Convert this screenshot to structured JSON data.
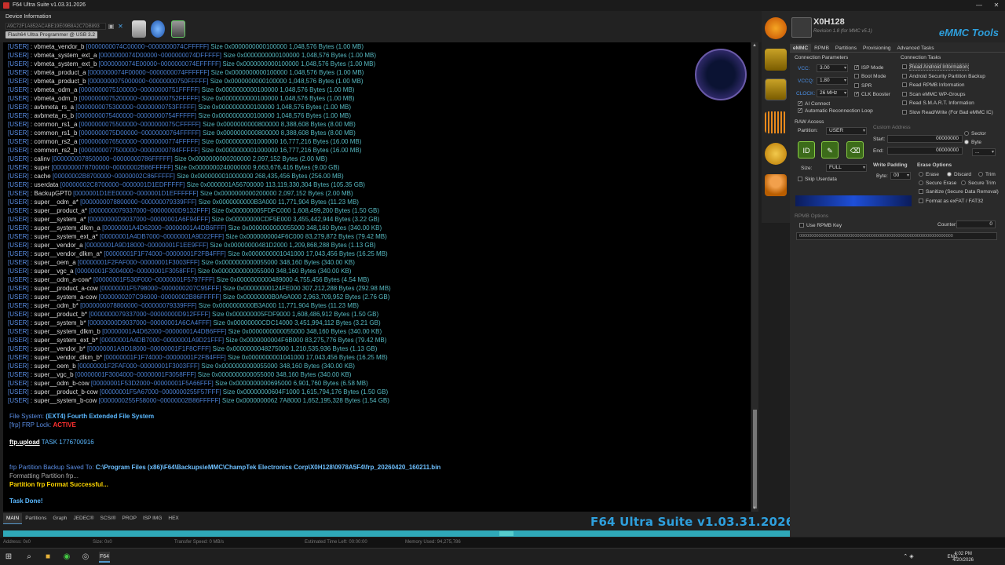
{
  "window": {
    "title": "F64 Ultra Suite v1.03.31.2026"
  },
  "device": {
    "label": "Device Information",
    "hash": "A9C72F1A852ACABE19E09B8A2C7DB893",
    "programmer": "Flash64 Ultra Programmer @ USB 3.2"
  },
  "log": {
    "partitions": [
      {
        "tag": "[USER]",
        "name": ": vbmeta_vendor_b",
        "range": "[0000000074C00000~0000000074CFFFFF]",
        "size": "Size 0x0000000000100000 1,048,576 Bytes (1.00 MB)"
      },
      {
        "tag": "[USER]",
        "name": ": vbmeta_system_ext_a",
        "range": "[0000000074D00000~0000000074DFFFFF]",
        "size": "Size 0x0000000000100000 1,048,576 Bytes (1.00 MB)"
      },
      {
        "tag": "[USER]",
        "name": ": vbmeta_system_ext_b",
        "range": "[0000000074E00000~0000000074EFFFFF]",
        "size": "Size 0x0000000000100000 1,048,576 Bytes (1.00 MB)"
      },
      {
        "tag": "[USER]",
        "name": ": vbmeta_product_a",
        "range": "[0000000074F00000~0000000074FFFFFF]",
        "size": "Size 0x0000000000100000 1,048,576 Bytes (1.00 MB)"
      },
      {
        "tag": "[USER]",
        "name": ": vbmeta_product_b",
        "range": "[0000000075000000~00000000750FFFFF]",
        "size": "Size 0x0000000000100000 1,048,576 Bytes (1.00 MB)"
      },
      {
        "tag": "[USER]",
        "name": ": vbmeta_odm_a",
        "range": "[0000000075100000~00000000751FFFFF]",
        "size": "Size 0x0000000000100000 1,048,576 Bytes (1.00 MB)"
      },
      {
        "tag": "[USER]",
        "name": ": vbmeta_odm_b",
        "range": "[0000000075200000~00000000752FFFFF]",
        "size": "Size 0x0000000000100000 1,048,576 Bytes (1.00 MB)"
      },
      {
        "tag": "[USER]",
        "name": ": avbmeta_rs_a",
        "range": "[0000000075300000~00000000753FFFFF]",
        "size": "Size 0x0000000000100000 1,048,576 Bytes (1.00 MB)"
      },
      {
        "tag": "[USER]",
        "name": ": avbmeta_rs_b",
        "range": "[0000000075400000~00000000754FFFFF]",
        "size": "Size 0x0000000000100000 1,048,576 Bytes (1.00 MB)"
      },
      {
        "tag": "[USER]",
        "name": ": common_rs1_a",
        "range": "[0000000075500000~0000000075CFFFFF]",
        "size": "Size 0x0000000000800000 8,388,608 Bytes (8.00 MB)"
      },
      {
        "tag": "[USER]",
        "name": ": common_rs1_b",
        "range": "[0000000075D00000~00000000764FFFFF]",
        "size": "Size 0x0000000000800000 8,388,608 Bytes (8.00 MB)"
      },
      {
        "tag": "[USER]",
        "name": ": common_rs2_a",
        "range": "[0000000076500000~00000000774FFFFF]",
        "size": "Size 0x0000000001000000 16,777,216 Bytes (16.00 MB)"
      },
      {
        "tag": "[USER]",
        "name": ": common_rs2_b",
        "range": "[0000000077500000~00000000784FFFFF]",
        "size": "Size 0x0000000001000000 16,777,216 Bytes (16.00 MB)"
      },
      {
        "tag": "[USER]",
        "name": ": calinv",
        "range": "[0000000078500000~00000000786FFFFF]",
        "size": "Size 0x0000000000200000 2,097,152 Bytes (2.00 MB)"
      },
      {
        "tag": "[USER]",
        "name": ": super",
        "range": "[0000000078700000~00000002B86FFFFF]",
        "size": "Size 0x0000000240000000 9,663,676,416 Bytes (9.00 GB)"
      },
      {
        "tag": "[USER]",
        "name": ": cache",
        "range": "[00000002B8700000~00000002C86FFFFF]",
        "size": "Size 0x0000000010000000 268,435,456 Bytes (256.00 MB)"
      },
      {
        "tag": "[USER]",
        "name": ": userdata",
        "range": "[00000002C8700000~0000001D1EDFFFFF]",
        "size": "Size 0x0000001A56700000 113,119,330,304 Bytes (105.35 GB)"
      },
      {
        "tag": "[USER]",
        "name": ": BackupGPT0",
        "range": "[0000001D1EE00000~0000001D1EFFFFFF]",
        "size": "Size 0x0000000000200000 2,097,152 Bytes (2.00 MB)"
      },
      {
        "tag": "[USER]",
        "name": ": super__odm_a*",
        "range": "[0000000078800000~000000079339FFF]",
        "size": "Size 0x0000000000B3A000 11,771,904 Bytes (11.23 MB)"
      },
      {
        "tag": "[USER]",
        "name": ": super__product_a*",
        "range": "[0000000079337000~00000000D9132FFF]",
        "size": "Size 0x000000005FDFC000 1,608,499,200 Bytes (1.50 GB)"
      },
      {
        "tag": "[USER]",
        "name": ": super__system_a*",
        "range": "[00000000D9037000~00000001A6F94FFF]",
        "size": "Size 0x00000000CDF5E000 3,455,442,944 Bytes (3.22 GB)"
      },
      {
        "tag": "[USER]",
        "name": ": super__system_dlkm_a",
        "range": "[00000001A4D62000~00000001A4DB6FFF]",
        "size": "Size 0x0000000000055000 348,160 Bytes (340.00 KB)"
      },
      {
        "tag": "[USER]",
        "name": ": super__system_ext_a*",
        "range": "[00000001A4DB7000~00000001A9D22FFF]",
        "size": "Size 0x0000000004F6C000 83,279,872 Bytes (79.42 MB)"
      },
      {
        "tag": "[USER]",
        "name": ": super__vendor_a",
        "range": "[00000001A9D18000~00000001F1EE9FFF]",
        "size": "Size 0x00000000481D2000 1,209,868,288 Bytes (1.13 GB)"
      },
      {
        "tag": "[USER]",
        "name": ": super__vendor_dlkm_a*",
        "range": "[00000001F1F74000~00000001F2FB4FFF]",
        "size": "Size 0x0000000001041000 17,043,456 Bytes (16.25 MB)"
      },
      {
        "tag": "[USER]",
        "name": ": super__oem_a",
        "range": "[00000001F2FAF000~00000001F3003FFF]",
        "size": "Size 0x0000000000055000 348,160 Bytes (340.00 KB)"
      },
      {
        "tag": "[USER]",
        "name": ": super__vgc_a",
        "range": "[00000001F3004000~00000001F3058FFF]",
        "size": "Size 0x0000000000055000 348,160 Bytes (340.00 KB)"
      },
      {
        "tag": "[USER]",
        "name": ": super__odm_a-cow*",
        "range": "[00000001F530F000~00000001F5797FFF]",
        "size": "Size 0x0000000000489000 4,755,456 Bytes (4.54 MB)"
      },
      {
        "tag": "[USER]",
        "name": ": super__product_a-cow",
        "range": "[00000001F5798000~0000000207C95FFF]",
        "size": "Size 0x00000000124FE000 307,212,288 Bytes (292.98 MB)"
      },
      {
        "tag": "[USER]",
        "name": ": super__system_a-cow",
        "range": "[0000000207C96000~00000002B86FFFFF]",
        "size": "Size 0x00000000B0A6A000 2,963,709,952 Bytes (2.76 GB)"
      },
      {
        "tag": "[USER]",
        "name": ": super__odm_b*",
        "range": "[0000000078800000~000000079339FFF]",
        "size": "Size 0x0000000000B3A000 11,771,904 Bytes (11.23 MB)"
      },
      {
        "tag": "[USER]",
        "name": ": super__product_b*",
        "range": "[0000000079337000~00000000D912FFFF]",
        "size": "Size 0x000000005FDF9000 1,608,486,912 Bytes (1.50 GB)"
      },
      {
        "tag": "[USER]",
        "name": ": super__system_b*",
        "range": "[00000000D9037000~00000001A6CA4FFF]",
        "size": "Size 0x00000000CDC14000 3,451,994,112 Bytes (3.21 GB)"
      },
      {
        "tag": "[USER]",
        "name": ": super__system_dlkm_b",
        "range": "[00000001A4D62000~00000001A4DB6FFF]",
        "size": "Size 0x0000000000055000 348,160 Bytes (340.00 KB)"
      },
      {
        "tag": "[USER]",
        "name": ": super__system_ext_b*",
        "range": "[00000001A4DB7000~00000001A9D21FFF]",
        "size": "Size 0x0000000004F6B000 83,275,776 Bytes (79.42 MB)"
      },
      {
        "tag": "[USER]",
        "name": ": super__vendor_b*",
        "range": "[00000001A9D18000~00000001F1F8CFFF]",
        "size": "Size 0x0000000048275000 1,210,535,936 Bytes (1.13 GB)"
      },
      {
        "tag": "[USER]",
        "name": ": super__vendor_dlkm_b*",
        "range": "[00000001F1F74000~00000001F2FB4FFF]",
        "size": "Size 0x0000000001041000 17,043,456 Bytes (16.25 MB)"
      },
      {
        "tag": "[USER]",
        "name": ": super__oem_b",
        "range": "[00000001F2FAF000~00000001F3003FFF]",
        "size": "Size 0x0000000000055000 348,160 Bytes (340.00 KB)"
      },
      {
        "tag": "[USER]",
        "name": ": super__vgc_b",
        "range": "[00000001F3004000~00000001F3058FFF]",
        "size": "Size 0x0000000000055000 348,160 Bytes (340.00 KB)"
      },
      {
        "tag": "[USER]",
        "name": ": super__odm_b-cow",
        "range": "[00000001F53D2000~00000001F5A66FFF]",
        "size": "Size 0x0000000000695000 6,901,760 Bytes (6.58 MB)"
      },
      {
        "tag": "[USER]",
        "name": ": super__product_b-cow",
        "range": "[00000001F5A67000~0000000255F57FFF]",
        "size": "Size 0x00000000604F1000 1,615,794,176 Bytes (1.50 GB)"
      },
      {
        "tag": "[USER]",
        "name": ": super__system_b-cow",
        "range": "[0000000255F58000~00000002B86FFFFF]",
        "size": "Size 0x0000000062 7A8000 1,652,195,328 Bytes (1.54 GB)"
      }
    ],
    "fs_label": "File System:",
    "fs_value": "(EXT4) Fourth Extended File System",
    "frp_label": "[frp] FRP Lock:",
    "frp_value": "ACTIVE",
    "upload_label": "ftp.upload",
    "upload_task": "TASK 1776700916",
    "backup_label": "frp Partition Backup Saved To:",
    "backup_path": "C:\\Program Files (x86)\\F64\\Backups\\eMMC\\ChampTek Electronics Corp\\X0H128\\0978A5F4\\frp_20260420_160211.bin",
    "formatting": "Formatting Partition frp...",
    "format_ok": "Partition frp Format Successful...",
    "done": "Task Done!"
  },
  "bottom_tabs": [
    "MAIN",
    "Partitions",
    "Graph",
    "JEDEC®",
    "SCSI®",
    "PROP",
    "ISP IMG",
    "HEX"
  ],
  "brand": "F64 Ultra Suite v1.03.31.2026",
  "status": {
    "address": "Address: 0x0",
    "size": "Size: 0x0",
    "speed": "Transfer Speed: 0 MB/s",
    "time_left": "Estimated Time Left: 00:00:00",
    "memory": "Memory Used: 94,275,786"
  },
  "taskbar": {
    "lang": "ENG",
    "time": "4:02 PM",
    "date": "4/20/2026"
  },
  "panel": {
    "chip_name": "X0H128",
    "revision": "Revision 1.8 (for MMC v5.1)",
    "title": "eMMC Tools",
    "tabs": [
      "eMMC",
      "RPMB",
      "Partitions",
      "Provisioning",
      "Advanced Tasks"
    ],
    "conn_params": "Connection Parameters",
    "vcc_label": "VCC:",
    "vcc": "3.00",
    "vccq_label": "VCCQ:",
    "vccq": "1.80",
    "clock_label": "CLOCK:",
    "clock": "26 MHz",
    "isp_mode": "ISP Mode",
    "boot_mode": "Boot Mode",
    "spr": "SPR",
    "clk_booster": "CLK Booster",
    "ai_connect": "AI Connect",
    "auto_reconnect": "Automatic Reconnection Loop",
    "conn_tasks": "Connection Tasks",
    "tasks": [
      "Read Android Information",
      "Android Security Partition Backup",
      "Read RPMB Information",
      "Scan eMMC WP-Groups",
      "Read S.M.A.R.T. Information",
      "Slow Read/Write (For Bad eMMC IC)"
    ],
    "raw_access": "RAW Access",
    "partition_label": "Partition:",
    "partition": "USER",
    "custom_address": "Custom Address",
    "start_label": "Start:",
    "start": "00000000",
    "end_label": "End:",
    "end": "00000000",
    "sector": "Sector",
    "byte": "Byte",
    "unit_select": "...",
    "size_label": "Size:",
    "size": "FULL",
    "write_padding": "Write Padding",
    "byte_label": "Byte:",
    "byte_value": "00",
    "skip_userdata": "Skip Userdata",
    "erase_options": "Erase Options",
    "erase": "Erase",
    "discard": "Discard",
    "trim": "Trim",
    "secure_erase": "Secure Erase",
    "secure_trim": "Secure Trim",
    "sanitize": "Sanitize (Secure Data Removal)",
    "format_exfat": "Format as exFAT / FAT32",
    "rpmb_options": "RPMB Options",
    "use_rpmb_key": "Use RPMB Key",
    "counter_label": "Counter:",
    "counter": "0",
    "rpmb_key": "0000000000000000000000000000000000000000000000000000000000000000"
  }
}
